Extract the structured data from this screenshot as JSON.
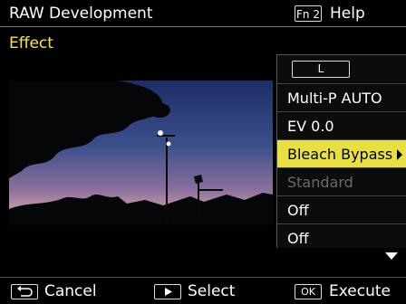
{
  "header": {
    "title": "RAW Development",
    "help_key": "Fn 2",
    "help_label": "Help"
  },
  "section_label": "Effect",
  "menu": {
    "size_chip": "L",
    "items": [
      {
        "label": "Multi-P AUTO",
        "state": "normal"
      },
      {
        "label": "EV 0.0",
        "state": "normal"
      },
      {
        "label": "Bleach Bypass",
        "state": "selected"
      },
      {
        "label": "Standard",
        "state": "disabled"
      },
      {
        "label": "Off",
        "state": "normal"
      },
      {
        "label": "Off",
        "state": "normal"
      }
    ]
  },
  "footer": {
    "cancel_label": "Cancel",
    "select_label": "Select",
    "execute_key": "OK",
    "execute_label": "Execute"
  },
  "colors": {
    "accent_yellow": "#ffe63a",
    "selected_bg": "#e8e043",
    "disabled_text": "#6a6a6a"
  }
}
